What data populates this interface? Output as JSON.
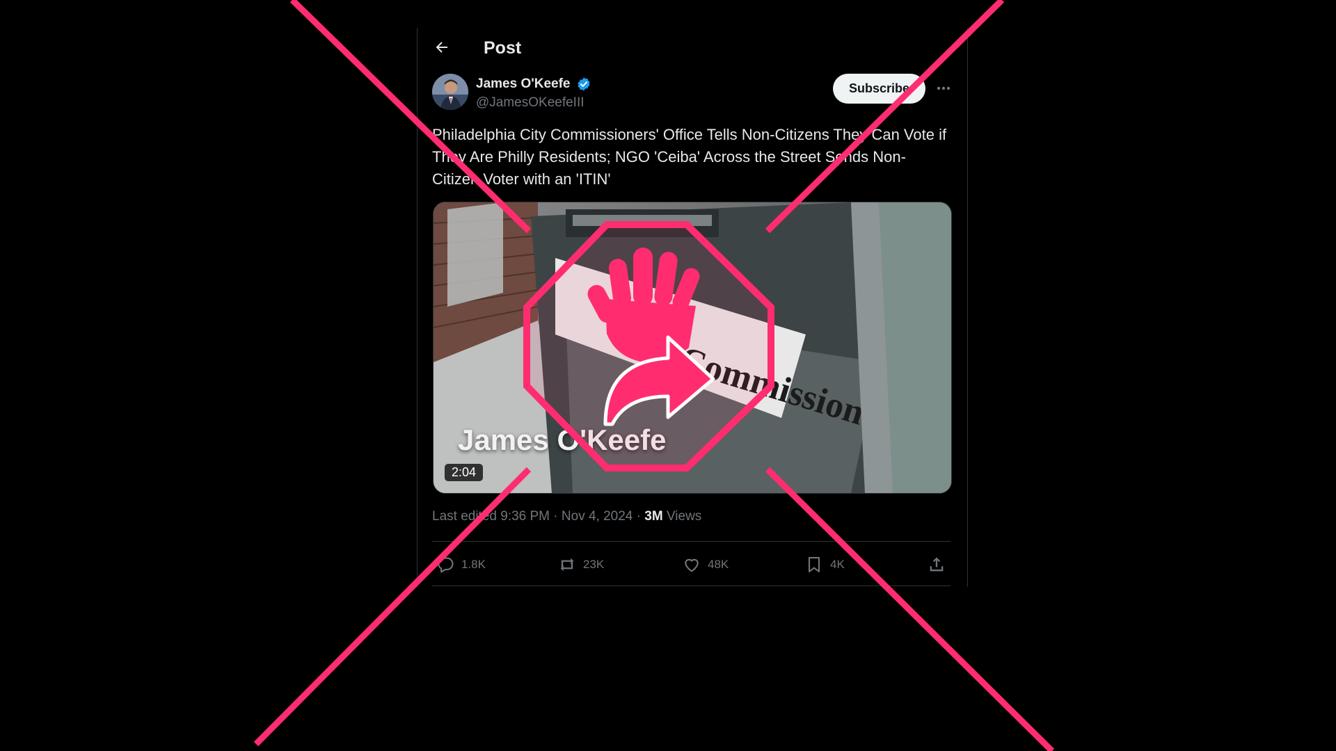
{
  "header": {
    "title": "Post"
  },
  "author": {
    "name": "James O'Keefe",
    "handle": "@JamesOKeefeIII",
    "subscribe_label": "Subscribe"
  },
  "post": {
    "text": "Philadelphia City Commissioners' Office Tells Non-Citizens They Can Vote if They Are Philly Residents; NGO 'Ceiba' Across the Street Sends Non-Citizen Voter with an 'ITIN'",
    "video": {
      "overlay_name": "James O'Keefe",
      "duration": "2:04",
      "sign_text_partial": "Commissioners"
    },
    "meta": {
      "edited_label": "Last edited",
      "time": "9:36 PM",
      "date": "Nov 4, 2024",
      "views_count": "3M",
      "views_label": "Views"
    },
    "stats": {
      "replies": "1.8K",
      "reposts": "23K",
      "likes": "48K",
      "bookmarks": "4K"
    }
  },
  "icons": {
    "back": "arrow-left-icon",
    "verified": "verified-badge-icon",
    "more": "more-horizontal-icon",
    "reply": "reply-icon",
    "repost": "repost-icon",
    "like": "heart-icon",
    "bookmark": "bookmark-icon",
    "share": "share-icon",
    "overlay": "stop-hand-share-icon"
  },
  "colors": {
    "background": "#000000",
    "overlay_pink": "#ff2d6f",
    "verified_blue": "#1d9bf0"
  }
}
